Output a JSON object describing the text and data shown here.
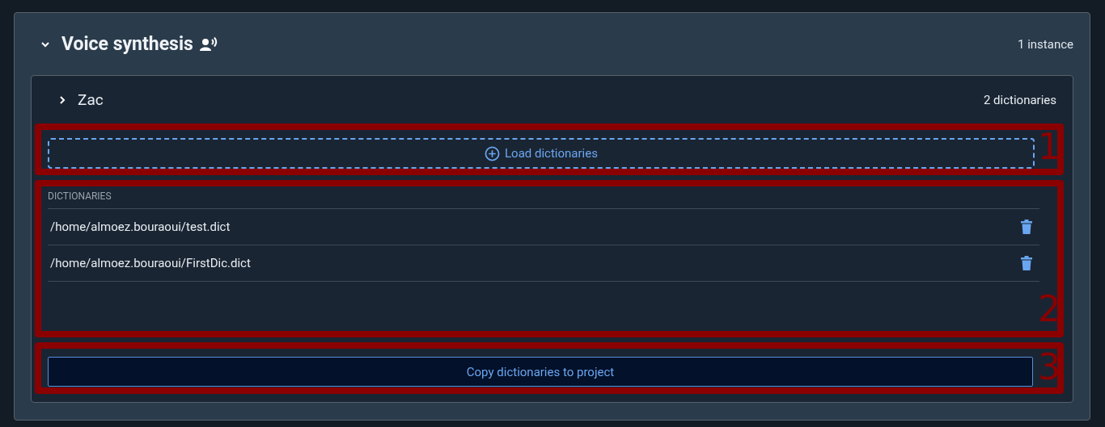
{
  "section": {
    "title": "Voice synthesis",
    "expanded": true,
    "count": "1 instance",
    "instances": [
      {
        "name": "Zac",
        "expanded": false,
        "count": "2 dictionaries",
        "load_button": "Load dictionaries",
        "list_header": "DICTIONARIES",
        "dictionaries": [
          {
            "path": "/home/almoez.bouraoui/test.dict"
          },
          {
            "path": "/home/almoez.bouraoui/FirstDic.dict"
          }
        ],
        "copy_button": "Copy dictionaries to project"
      }
    ]
  },
  "annotations": [
    {
      "label": "1"
    },
    {
      "label": "2"
    },
    {
      "label": "3"
    }
  ]
}
